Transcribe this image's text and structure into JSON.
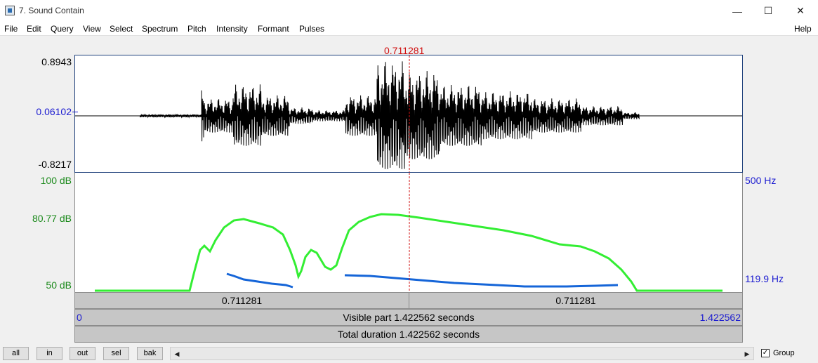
{
  "window": {
    "title": "7. Sound Contain",
    "controls": {
      "minimize": "—",
      "maximize": "☐",
      "close": "✕"
    }
  },
  "menu": {
    "items": [
      "File",
      "Edit",
      "Query",
      "View",
      "Select",
      "Spectrum",
      "Pitch",
      "Intensity",
      "Formant",
      "Pulses"
    ],
    "help": "Help"
  },
  "cursor": {
    "time_label": "0.711281",
    "time": 0.711281
  },
  "waveform": {
    "y_max": "0.8943",
    "y_mid": "0.06102",
    "y_min": "-0.8217"
  },
  "analysis": {
    "intensity_top": "100 dB",
    "intensity_mid": "80.77 dB",
    "intensity_bottom": "50 dB",
    "pitch_top": "500 Hz",
    "pitch_bottom": "119.9 Hz"
  },
  "bars": {
    "left_segment": "0.711281",
    "right_segment": "0.711281",
    "visible_start": "0",
    "visible_label": "Visible part 1.422562 seconds",
    "visible_end": "1.422562",
    "total_label": "Total duration 1.422562 seconds"
  },
  "buttons": {
    "all": "all",
    "in": "in",
    "out": "out",
    "sel": "sel",
    "bak": "bak"
  },
  "scroll": {
    "left_arrow": "◀",
    "right_arrow": "▶"
  },
  "group": {
    "checked_mark": "✓",
    "label": "Group"
  },
  "colors": {
    "intensity": "#33ee33",
    "pitch": "#1565d8",
    "cursor": "#d01010",
    "waveform": "#000000",
    "frame": "#1d3f7a"
  }
}
